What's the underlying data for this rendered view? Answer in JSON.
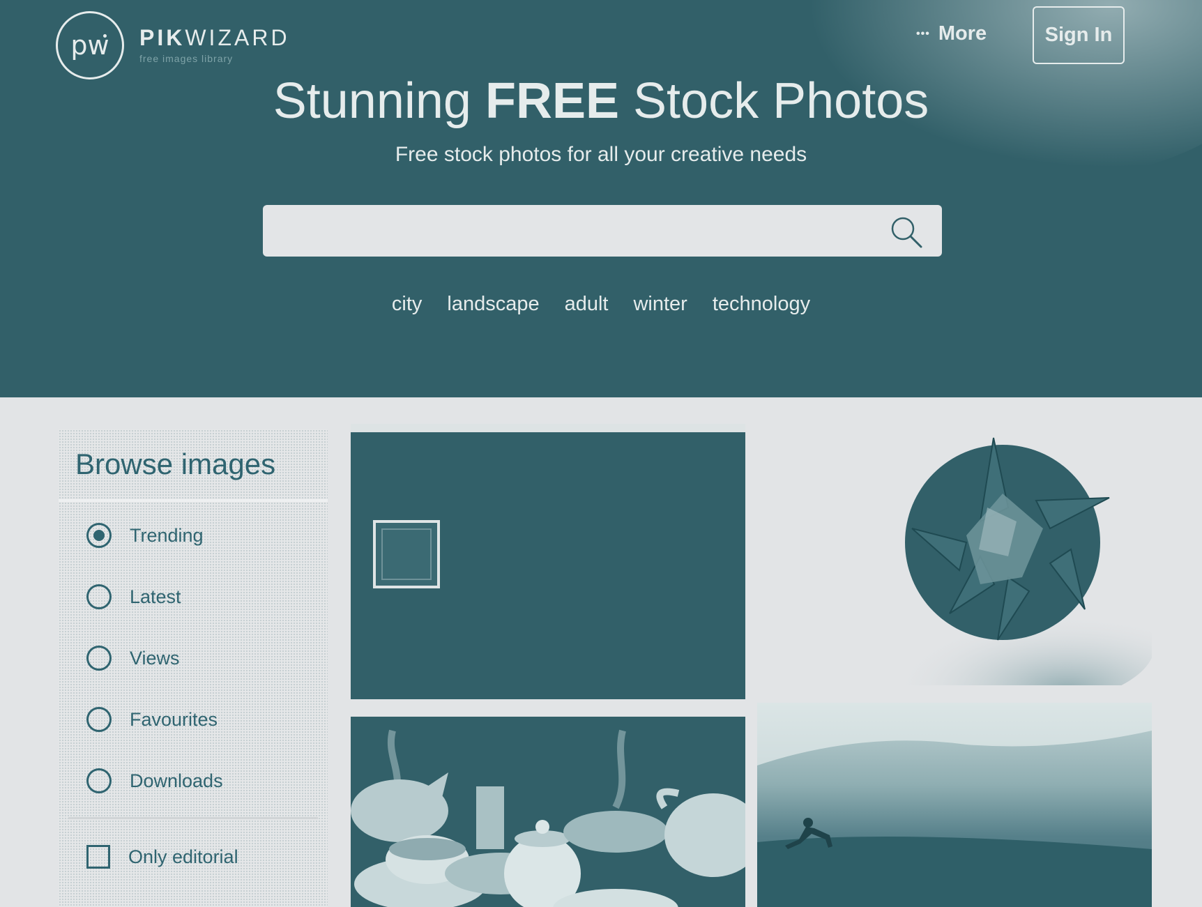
{
  "brand": {
    "logo_mark": "pw",
    "name_bold": "PIK",
    "name_light": "WIZARD",
    "tagline": "free images library"
  },
  "nav": {
    "more_dots": "•••",
    "more_label": "More",
    "signin_label": "Sign In"
  },
  "hero": {
    "title_pre": "Stunning ",
    "title_bold": "FREE",
    "title_post": " Stock Photos",
    "subtitle": "Free stock photos for all your creative needs",
    "search_placeholder": "",
    "tags": [
      "city",
      "landscape",
      "adult",
      "winter",
      "technology"
    ]
  },
  "sidebar": {
    "heading": "Browse images",
    "options": [
      {
        "label": "Trending",
        "checked": true
      },
      {
        "label": "Latest",
        "checked": false
      },
      {
        "label": "Views",
        "checked": false
      },
      {
        "label": "Favourites",
        "checked": false
      },
      {
        "label": "Downloads",
        "checked": false
      }
    ],
    "editorial_label": "Only editorial",
    "editorial_checked": false
  },
  "colors": {
    "primary": "#326069",
    "background": "#e2e4e6",
    "hero_text": "#e6ecec"
  },
  "icons": [
    "search-icon",
    "more-dots-icon",
    "radio-icon",
    "checkbox-icon"
  ]
}
